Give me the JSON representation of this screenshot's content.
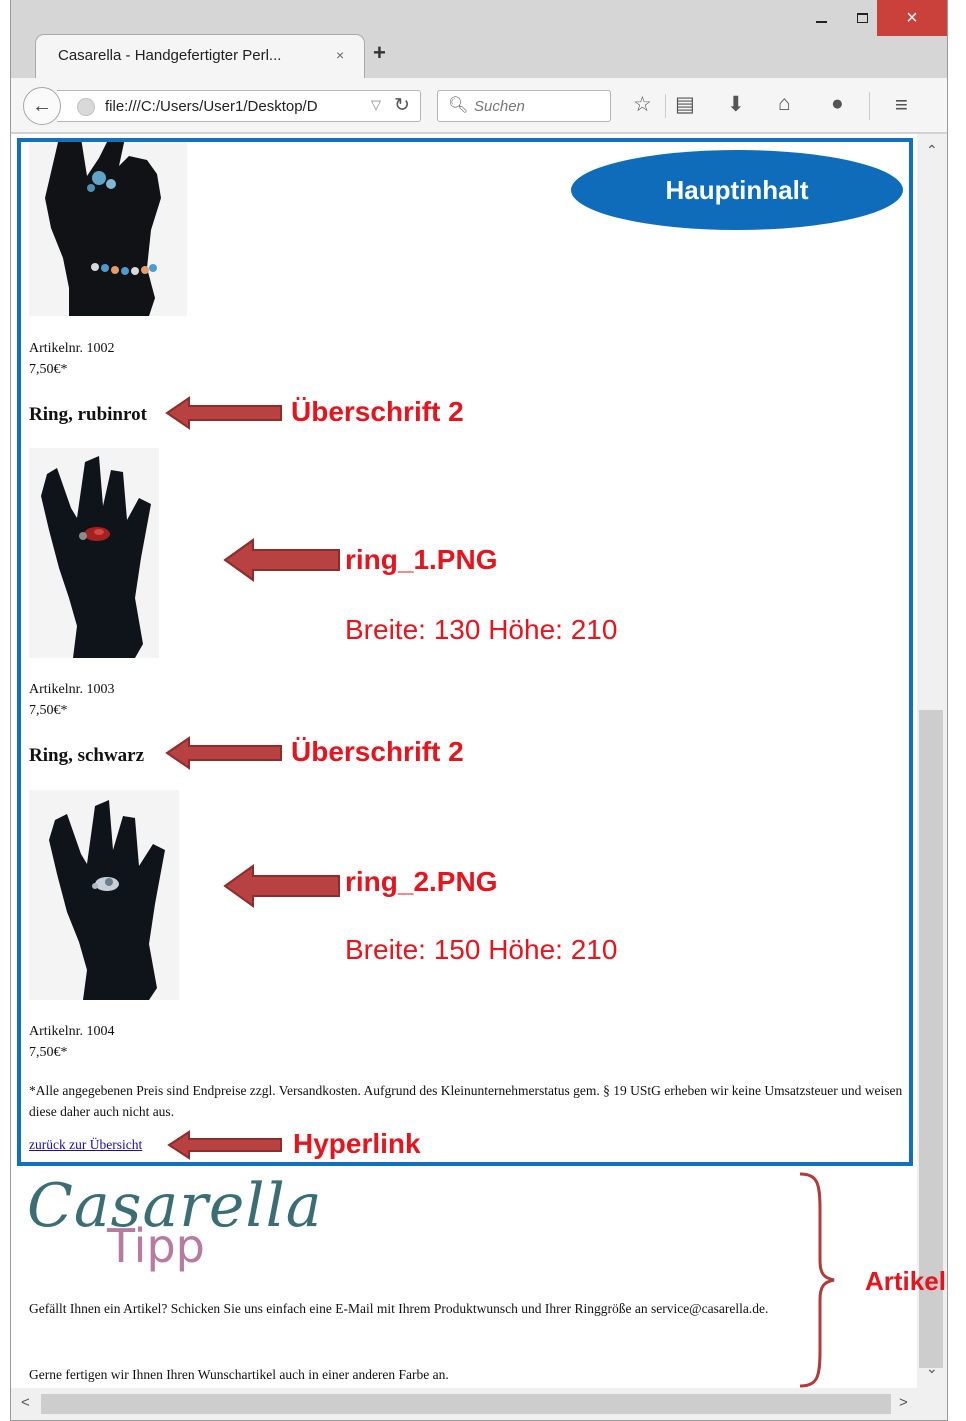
{
  "browser": {
    "tab_title": "Casarella - Handgefertigter Perl...",
    "tab_close": "×",
    "new_tab": "+",
    "url": "file:///C:/Users/User1/Desktop/D",
    "search_placeholder": "Suchen",
    "window_controls": {
      "close": "×"
    }
  },
  "page": {
    "item_1002": {
      "number": "Artikelnr. 1002",
      "price": "7,50€*"
    },
    "heading_ruby": "Ring, rubinrot",
    "item_1003": {
      "number": "Artikelnr. 1003",
      "price": "7,50€*"
    },
    "heading_black": "Ring, schwarz",
    "item_1004": {
      "number": "Artikelnr. 1004",
      "price": "7,50€*"
    },
    "footnote": "*Alle angegebenen Preis sind Endpreise zzgl. Versandkosten. Aufgrund des Kleinunternehmerstatus gem. § 19 UStG erheben wir keine Umsatzsteuer und weisen diese daher auch nicht aus.",
    "back_link": "zurück zur Übersicht",
    "logo_script": "Casarella",
    "logo_tipp": "Tipp",
    "tip_text_1": "Gefällt Ihnen ein Artikel? Schicken Sie uns einfach eine E-Mail mit Ihrem Produktwunsch und Ihrer Ringgröße an service@casarella.de.",
    "tip_text_2": "Gerne fertigen wir Ihnen Ihren Wunschartikel auch in einer anderen Farbe an."
  },
  "annotations": {
    "hauptinhalt": "Hauptinhalt",
    "ueberschrift_1": "Überschrift 2",
    "ring1_file": "ring_1.PNG",
    "ring1_size": "Breite: 130 Höhe: 210",
    "ueberschrift_2": "Überschrift 2",
    "ring2_file": "ring_2.PNG",
    "ring2_size": "Breite: 150 Höhe: 210",
    "hyperlink": "Hyperlink",
    "artikel": "Artikel"
  },
  "colors": {
    "annotation_red": "#e5141d",
    "frame_blue": "#1270c0",
    "arrow_fill": "#b84242",
    "link_blue": "#1a0dab",
    "logo_teal": "#3b6e74",
    "logo_pink": "#b77aa0"
  },
  "icons": [
    "back-icon",
    "globe-icon",
    "reload-icon",
    "search-icon",
    "star-icon",
    "reading-list-icon",
    "download-icon",
    "home-icon",
    "chat-icon",
    "menu-icon"
  ]
}
